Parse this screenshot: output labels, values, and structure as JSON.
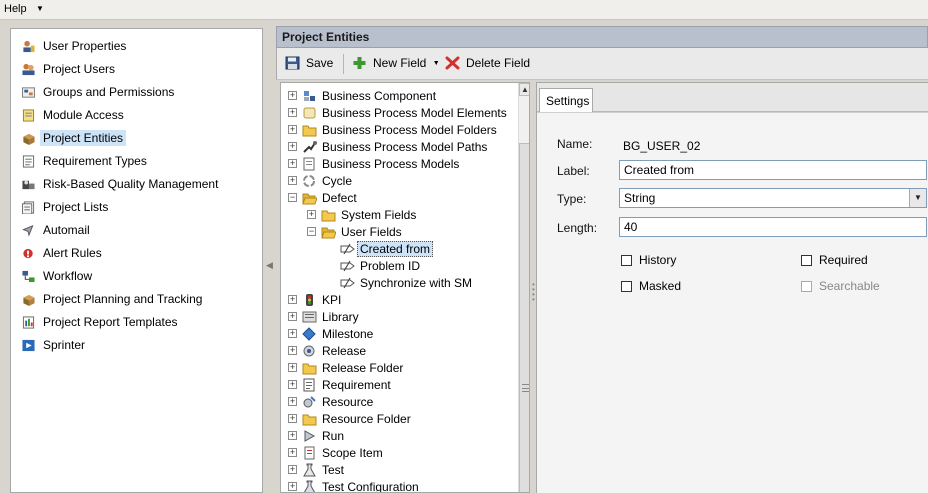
{
  "menubar": {
    "help": "Help"
  },
  "sidebar": {
    "items": [
      {
        "label": "User Properties",
        "icon": "user-properties-icon"
      },
      {
        "label": "Project Users",
        "icon": "project-users-icon"
      },
      {
        "label": "Groups and Permissions",
        "icon": "groups-icon"
      },
      {
        "label": "Module Access",
        "icon": "module-access-icon"
      },
      {
        "label": "Project Entities",
        "icon": "project-entities-icon",
        "selected": true
      },
      {
        "label": "Requirement Types",
        "icon": "requirement-types-icon"
      },
      {
        "label": "Risk-Based Quality Management",
        "icon": "risk-icon"
      },
      {
        "label": "Project Lists",
        "icon": "project-lists-icon"
      },
      {
        "label": "Automail",
        "icon": "automail-icon"
      },
      {
        "label": "Alert Rules",
        "icon": "alert-rules-icon"
      },
      {
        "label": "Workflow",
        "icon": "workflow-icon"
      },
      {
        "label": "Project Planning and Tracking",
        "icon": "planning-icon"
      },
      {
        "label": "Project Report Templates",
        "icon": "report-templates-icon"
      },
      {
        "label": "Sprinter",
        "icon": "sprinter-icon"
      }
    ]
  },
  "main": {
    "title": "Project Entities",
    "toolbar": {
      "save": "Save",
      "new_field": "New Field",
      "delete_field": "Delete Field"
    },
    "tree": [
      {
        "label": "Business Component",
        "level": 0,
        "expand": "+",
        "icon": "component-icon"
      },
      {
        "label": "Business Process Model Elements",
        "level": 0,
        "expand": "+",
        "icon": "bpm-elements-icon"
      },
      {
        "label": "Business Process Model Folders",
        "level": 0,
        "expand": "+",
        "icon": "folder-icon"
      },
      {
        "label": "Business Process Model Paths",
        "level": 0,
        "expand": "+",
        "icon": "bpm-paths-icon"
      },
      {
        "label": "Business Process Models",
        "level": 0,
        "expand": "+",
        "icon": "bpm-models-icon"
      },
      {
        "label": "Cycle",
        "level": 0,
        "expand": "+",
        "icon": "cycle-icon"
      },
      {
        "label": "Defect",
        "level": 0,
        "expand": "−",
        "icon": "folder-open-icon"
      },
      {
        "label": "System Fields",
        "level": 1,
        "expand": "+",
        "icon": "folder-icon"
      },
      {
        "label": "User Fields",
        "level": 1,
        "expand": "−",
        "icon": "folder-open-icon"
      },
      {
        "label": "Created from",
        "level": 2,
        "expand": "",
        "icon": "field-icon",
        "selected": true
      },
      {
        "label": "Problem ID",
        "level": 2,
        "expand": "",
        "icon": "field-icon"
      },
      {
        "label": "Synchronize with SM",
        "level": 2,
        "expand": "",
        "icon": "field-icon"
      },
      {
        "label": "KPI",
        "level": 0,
        "expand": "+",
        "icon": "kpi-icon"
      },
      {
        "label": "Library",
        "level": 0,
        "expand": "+",
        "icon": "library-icon"
      },
      {
        "label": "Milestone",
        "level": 0,
        "expand": "+",
        "icon": "milestone-icon"
      },
      {
        "label": "Release",
        "level": 0,
        "expand": "+",
        "icon": "release-icon"
      },
      {
        "label": "Release Folder",
        "level": 0,
        "expand": "+",
        "icon": "folder-icon"
      },
      {
        "label": "Requirement",
        "level": 0,
        "expand": "+",
        "icon": "requirement-icon"
      },
      {
        "label": "Resource",
        "level": 0,
        "expand": "+",
        "icon": "resource-icon"
      },
      {
        "label": "Resource Folder",
        "level": 0,
        "expand": "+",
        "icon": "folder-icon"
      },
      {
        "label": "Run",
        "level": 0,
        "expand": "+",
        "icon": "run-icon"
      },
      {
        "label": "Scope Item",
        "level": 0,
        "expand": "+",
        "icon": "scope-item-icon"
      },
      {
        "label": "Test",
        "level": 0,
        "expand": "+",
        "icon": "test-icon"
      },
      {
        "label": "Test Configuration",
        "level": 0,
        "expand": "+",
        "icon": "test-config-icon"
      }
    ],
    "settings": {
      "tab": "Settings",
      "name_label": "Name:",
      "name_value": "BG_USER_02",
      "label_label": "Label:",
      "label_value": "Created from",
      "type_label": "Type:",
      "type_value": "String",
      "length_label": "Length:",
      "length_value": "40",
      "history": "History",
      "required": "Required",
      "masked": "Masked",
      "searchable": "Searchable"
    }
  },
  "colors": {
    "selection": "#cde3f7",
    "header": "#b8bfcd",
    "folder": "#f2c94c",
    "delete": "#d0312d",
    "add": "#3b9a2c"
  }
}
